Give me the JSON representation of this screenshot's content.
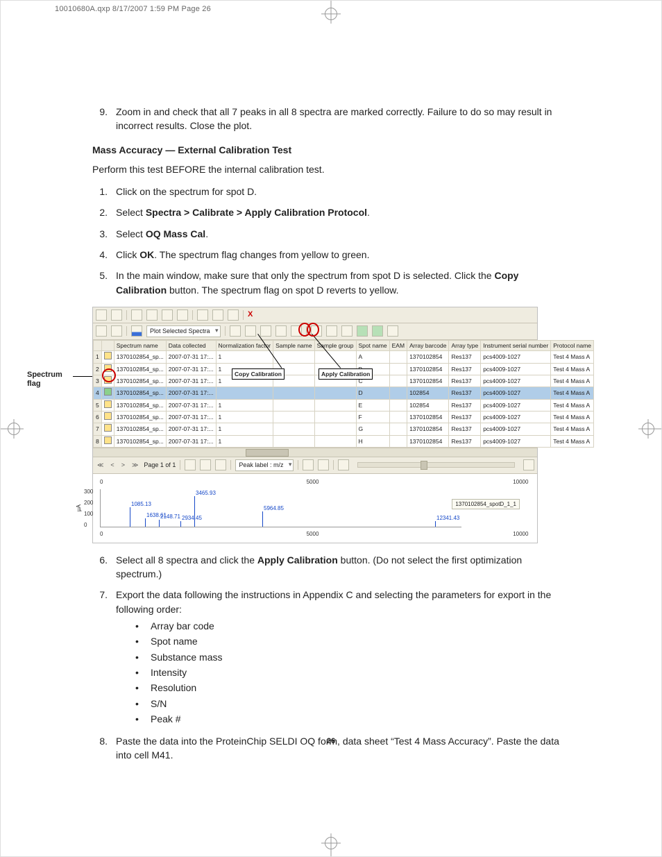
{
  "slug": "10010680A.qxp  8/17/2007  1:59 PM  Page 26",
  "page_number": "26",
  "steps_top": {
    "n9": "9.",
    "t9": "Zoom in and check that all 7 peaks in all 8 spectra are marked correctly. Failure to do so may result in incorrect results. Close the plot."
  },
  "section_title": "Mass Accuracy — External Calibration Test",
  "section_sub": "Perform this test BEFORE the internal calibration test.",
  "steps_a": {
    "n1": "1.",
    "t1": "Click on the spectrum for spot D.",
    "n2": "2.",
    "t2_pre": "Select ",
    "t2_b": "Spectra > Calibrate > Apply Calibration Protocol",
    "t2_post": ".",
    "n3": "3.",
    "t3_pre": "Select ",
    "t3_b": "OQ Mass Cal",
    "t3_post": ".",
    "n4": "4.",
    "t4_pre": "Click ",
    "t4_b": "OK",
    "t4_post": ". The spectrum flag changes from yellow to green.",
    "n5": "5.",
    "t5_a": "In the main window, make sure that only the spectrum from spot D is selected. Click the ",
    "t5_b": "Copy Calibration",
    "t5_c": " button. The spectrum flag on spot D reverts to yellow."
  },
  "fig": {
    "side_label_1": "Spectrum",
    "side_label_2": "flag",
    "toolbar_dd": "Plot Selected Spectra",
    "toolbar_x": "X",
    "callout_copy": "Copy Calibration",
    "callout_apply": "Apply Calibration",
    "headers": [
      "",
      "",
      "Spectrum name",
      "Data collected",
      "Normalization factor",
      "Sample name",
      "Sample group",
      "Spot name",
      "EAM",
      "Array barcode",
      "Array type",
      "Instrument serial number",
      "Protocol name"
    ],
    "rows": [
      {
        "n": "1",
        "name": "1370102854_sp...",
        "date": "2007-07-31 17:...",
        "nf": "1",
        "spot": "A",
        "bar": "1370102854",
        "atype": "Res137",
        "inst": "pcs4009-1027",
        "prot": "Test 4 Mass A"
      },
      {
        "n": "2",
        "name": "1370102854_sp...",
        "date": "2007-07-31 17:...",
        "nf": "1",
        "spot": "B",
        "bar": "1370102854",
        "atype": "Res137",
        "inst": "pcs4009-1027",
        "prot": "Test 4 Mass A"
      },
      {
        "n": "3",
        "name": "1370102854_sp...",
        "date": "2007-07-31 17:...",
        "nf": "1",
        "spot": "C",
        "bar": "1370102854",
        "atype": "Res137",
        "inst": "pcs4009-1027",
        "prot": "Test 4 Mass A"
      },
      {
        "n": "4",
        "name": "1370102854_sp...",
        "date": "2007-07-31 17:...",
        "nf": "",
        "spot": "D",
        "bar": "102854",
        "atype": "Res137",
        "inst": "pcs4009-1027",
        "prot": "Test 4 Mass A",
        "sel": true,
        "green": true
      },
      {
        "n": "5",
        "name": "1370102854_sp...",
        "date": "2007-07-31 17:...",
        "nf": "1",
        "spot": "E",
        "bar": "102854",
        "atype": "Res137",
        "inst": "pcs4009-1027",
        "prot": "Test 4 Mass A"
      },
      {
        "n": "6",
        "name": "1370102854_sp...",
        "date": "2007-07-31 17:...",
        "nf": "1",
        "spot": "F",
        "bar": "1370102854",
        "atype": "Res137",
        "inst": "pcs4009-1027",
        "prot": "Test 4 Mass A"
      },
      {
        "n": "7",
        "name": "1370102854_sp...",
        "date": "2007-07-31 17:...",
        "nf": "1",
        "spot": "G",
        "bar": "1370102854",
        "atype": "Res137",
        "inst": "pcs4009-1027",
        "prot": "Test 4 Mass A"
      },
      {
        "n": "8",
        "name": "1370102854_sp...",
        "date": "2007-07-31 17:...",
        "nf": "1",
        "spot": "H",
        "bar": "1370102854",
        "atype": "Res137",
        "inst": "pcs4009-1027",
        "prot": "Test 4 Mass A"
      }
    ],
    "pager": {
      "first": "≪",
      "prev": "<",
      "next": ">",
      "last": "≫",
      "page": "Page 1 of 1",
      "peak_dd": "Peak label : m/z"
    },
    "axis": {
      "t0": "0",
      "t1": "5000",
      "t2": "10000"
    },
    "yticks": {
      "y300": "300",
      "y200": "200",
      "y100": "100",
      "y0": "0"
    },
    "ylabel": "µA",
    "peaks": {
      "p1": "1085.13",
      "p2a": "1638.61",
      "p2": "2148.71",
      "p3": "2934.45",
      "p4": "3465.93",
      "p5": "5964.85",
      "p6": "12341.43"
    },
    "legend": "1370102854_spotD_1_1"
  },
  "steps_b": {
    "n6": "6.",
    "t6_a": "Select all 8 spectra and click the ",
    "t6_b": "Apply Calibration",
    "t6_c": " button. (Do not select the first optimization spectrum.)",
    "n7": "7.",
    "t7": "Export the data following the instructions in Appendix C and selecting the parameters for export in the following order:",
    "bullets": [
      "Array bar code",
      "Spot name",
      "Substance mass",
      "Intensity",
      "Resolution",
      "S/N",
      "Peak #"
    ],
    "n8": "8.",
    "t8": "Paste the data into the ProteinChip SELDI OQ form, data sheet “Test 4 Mass Accuracy”. Paste the data into cell M41."
  }
}
